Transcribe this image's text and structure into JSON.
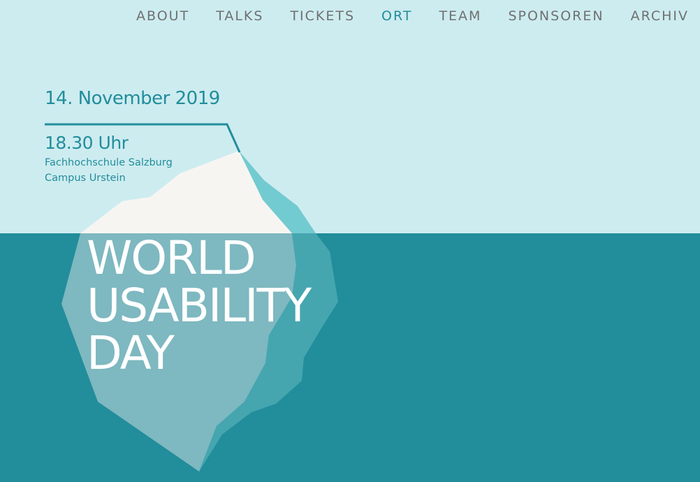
{
  "nav": {
    "items": [
      "ABOUT",
      "TALKS",
      "TICKETS",
      "ORT",
      "TEAM",
      "SPONSOREN",
      "ARCHIV"
    ],
    "active": "ORT"
  },
  "event": {
    "date": "14. November 2019",
    "time": "18.30 Uhr",
    "venue_line1": "Fachhochschule Salzburg",
    "venue_line2": "Campus Urstein"
  },
  "headline": {
    "line1": "WORLD",
    "line2": "USABILITY",
    "line3": "DAY"
  },
  "colors": {
    "sky": "#cdecf0",
    "sea": "#228d9b",
    "accent": "#228d9b",
    "nav_text": "#707070",
    "ice_top": "#f7f5f2",
    "ice_side": "#72cbd0"
  }
}
